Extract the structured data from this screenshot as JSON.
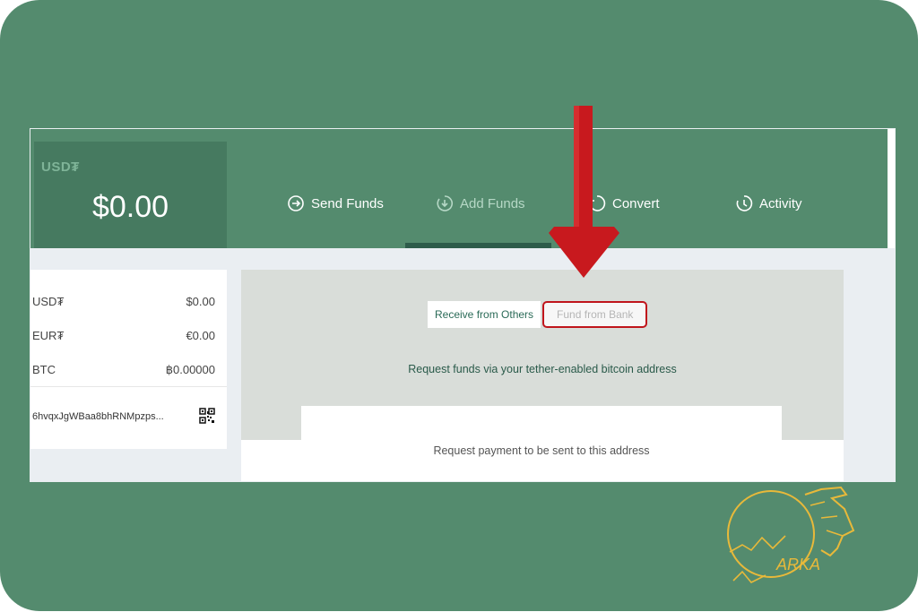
{
  "balance": {
    "label": "USD₮",
    "value": "$0.00"
  },
  "nav": [
    {
      "label": "Send Funds",
      "icon": "send-funds-icon"
    },
    {
      "label": "Add Funds",
      "icon": "add-funds-icon",
      "active": true
    },
    {
      "label": "Convert",
      "icon": "convert-icon"
    },
    {
      "label": "Activity",
      "icon": "activity-icon"
    }
  ],
  "wallets": [
    {
      "currency": "USD₮",
      "amount": "$0.00"
    },
    {
      "currency": "EUR₮",
      "amount": "€0.00"
    },
    {
      "currency": "BTC",
      "amount": "฿0.00000"
    }
  ],
  "address": {
    "text": "6hvqxJgWBaa8bhRNMpzps...",
    "icon": "qr-code-icon"
  },
  "tabs": {
    "receive": "Receive from Others",
    "bank": "Fund from Bank"
  },
  "main": {
    "info": "Request funds via your tether-enabled bitcoin address",
    "card_text": "Request payment to be sent to this address"
  },
  "logo": {
    "text": "ARKA"
  },
  "colors": {
    "frame": "#548b6e",
    "topbar": "#548b6e",
    "highlight": "#c0151c",
    "arrow": "#c8191e"
  }
}
